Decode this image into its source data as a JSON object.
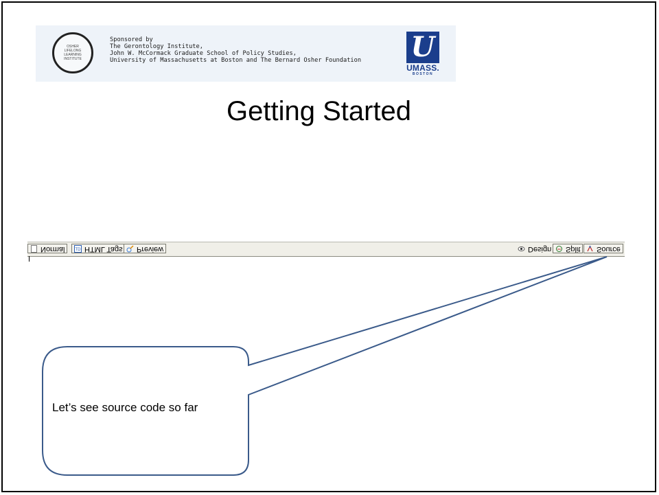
{
  "banner": {
    "logo_text": "OSHER\nLIFELONG\nLEARNING\nINSTITUTE",
    "sponsor_lines": [
      "Sponsored by",
      "The Gerontology Institute,",
      "John W. McCormack Graduate School of Policy Studies,",
      "University of Massachusetts at Boston and The Bernard Osher Foundation"
    ],
    "umass_mark": "U",
    "umass_word": "UMASS.",
    "umass_sub": "BOSTON",
    "umass_color": "#1b3e8c"
  },
  "slide": {
    "title": "Getting Started"
  },
  "editor_bar": {
    "left_tabs": [
      {
        "label": "Normal",
        "icon": "page-icon"
      },
      {
        "label": "HTML Tags",
        "icon": "html-tags-icon"
      },
      {
        "label": "Preview",
        "icon": "preview-icon"
      }
    ],
    "right_tabs": [
      {
        "label": "Design",
        "icon": "eye-icon"
      },
      {
        "label": "Split",
        "icon": "split-icon"
      },
      {
        "label": "Source",
        "icon": "source-icon"
      }
    ]
  },
  "callout": {
    "text": "Let’s see source code so far",
    "border_color": "#3a5a8a"
  }
}
